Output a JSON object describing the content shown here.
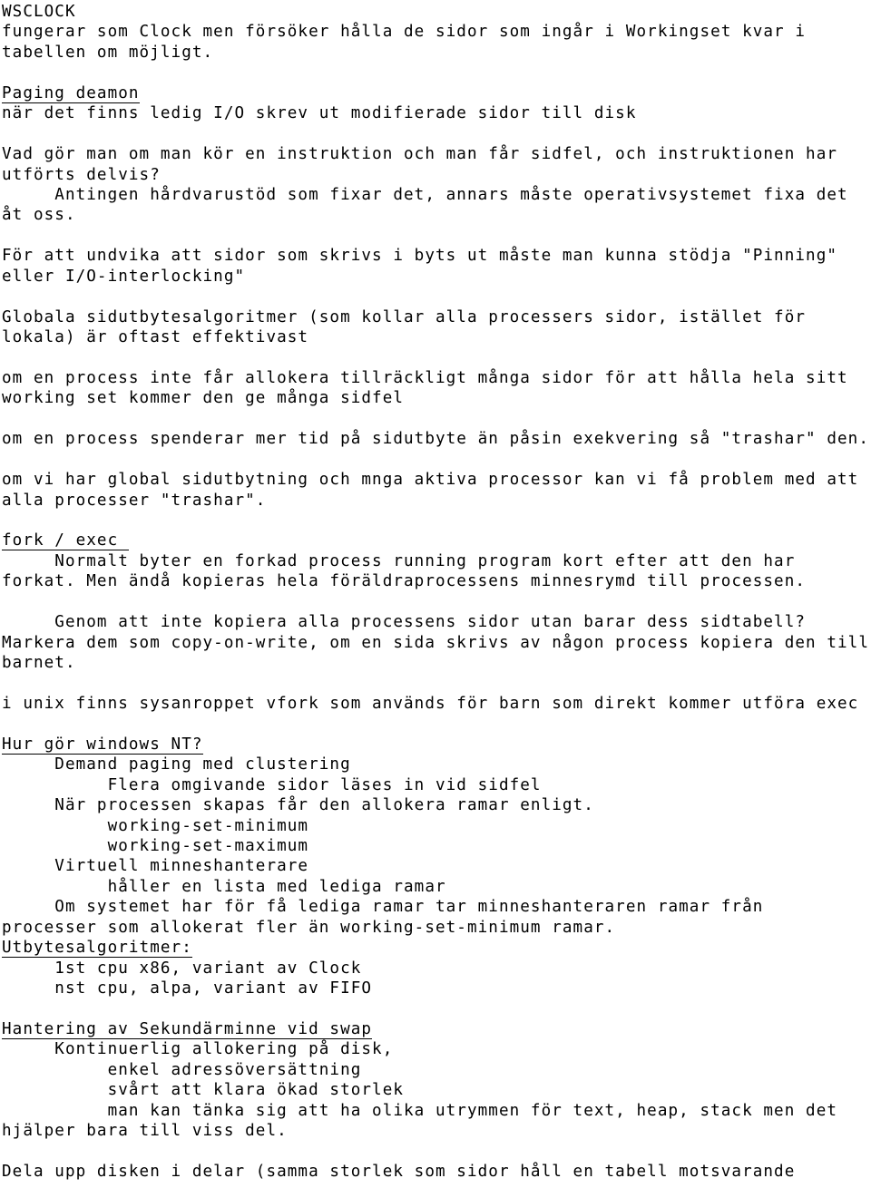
{
  "document": {
    "title": "WSCLOCK",
    "language": "sv",
    "background_color": "#ffffff",
    "text_color": "#000000",
    "lines": [
      {
        "text": "WSCLOCK",
        "style": "plain"
      },
      {
        "text": "fungerar som Clock men försöker hålla de sidor som ingår i Workingset kvar i",
        "style": "plain"
      },
      {
        "text": "tabellen om möjligt.",
        "style": "plain"
      },
      {
        "text": "",
        "style": "blank"
      },
      {
        "text": "Paging deamon",
        "style": "heading"
      },
      {
        "text": "när det finns ledig I/O skrev ut modifierade sidor till disk",
        "style": "plain"
      },
      {
        "text": "",
        "style": "blank"
      },
      {
        "text": "Vad gör man om man kör en instruktion och man får sidfel, och instruktionen har",
        "style": "plain"
      },
      {
        "text": "utförts delvis?",
        "style": "plain"
      },
      {
        "text": "     Antingen hårdvarustöd som fixar det, annars måste operativsystemet fixa det",
        "style": "plain"
      },
      {
        "text": "åt oss.",
        "style": "plain"
      },
      {
        "text": "",
        "style": "blank"
      },
      {
        "text": "För att undvika att sidor som skrivs i byts ut måste man kunna stödja \"Pinning\"",
        "style": "plain"
      },
      {
        "text": "eller I/O-interlocking\"",
        "style": "plain"
      },
      {
        "text": "",
        "style": "blank"
      },
      {
        "text": "Globala sidutbytesalgoritmer (som kollar alla processers sidor, istället för",
        "style": "plain"
      },
      {
        "text": "lokala) är oftast effektivast",
        "style": "plain"
      },
      {
        "text": "",
        "style": "blank"
      },
      {
        "text": "om en process inte får allokera tillräckligt många sidor för att hålla hela sitt",
        "style": "plain"
      },
      {
        "text": "working set kommer den ge många sidfel",
        "style": "plain"
      },
      {
        "text": "",
        "style": "blank"
      },
      {
        "text": "om en process spenderar mer tid på sidutbyte än påsin exekvering så \"trashar\" den.",
        "style": "plain"
      },
      {
        "text": "",
        "style": "blank"
      },
      {
        "text": "om vi har global sidutbytning och mnga aktiva processor kan vi få problem med att",
        "style": "plain"
      },
      {
        "text": "alla processer \"trashar\".",
        "style": "plain"
      },
      {
        "text": "",
        "style": "blank"
      },
      {
        "text": "fork / exec ",
        "style": "heading"
      },
      {
        "text": "     Normalt byter en forkad process running program kort efter att den har",
        "style": "plain"
      },
      {
        "text": "forkat. Men ändå kopieras hela föräldraprocessens minnesrymd till processen.",
        "style": "plain"
      },
      {
        "text": "",
        "style": "blank"
      },
      {
        "text": "     Genom att inte kopiera alla processens sidor utan barar dess sidtabell?",
        "style": "plain"
      },
      {
        "text": "Markera dem som copy-on-write, om en sida skrivs av någon process kopiera den till",
        "style": "plain"
      },
      {
        "text": "barnet.",
        "style": "plain"
      },
      {
        "text": "",
        "style": "blank"
      },
      {
        "text": "i unix finns sysanroppet vfork som används för barn som direkt kommer utföra exec",
        "style": "plain"
      },
      {
        "text": "",
        "style": "blank"
      },
      {
        "text": "Hur gör windows NT?",
        "style": "heading"
      },
      {
        "text": "     Demand paging med clustering",
        "style": "plain"
      },
      {
        "text": "          Flera omgivande sidor läses in vid sidfel",
        "style": "plain"
      },
      {
        "text": "     När processen skapas får den allokera ramar enligt.",
        "style": "plain"
      },
      {
        "text": "          working-set-minimum",
        "style": "plain"
      },
      {
        "text": "          working-set-maximum",
        "style": "plain"
      },
      {
        "text": "     Virtuell minneshanterare",
        "style": "plain"
      },
      {
        "text": "          håller en lista med lediga ramar",
        "style": "plain"
      },
      {
        "text": "     Om systemet har för få lediga ramar tar minneshanteraren ramar från",
        "style": "plain"
      },
      {
        "text": "processer som allokerat fler än working-set-minimum ramar.",
        "style": "plain"
      },
      {
        "text": "Utbytesalgoritmer:",
        "style": "heading"
      },
      {
        "text": "     1st cpu x86, variant av Clock",
        "style": "plain"
      },
      {
        "text": "     nst cpu, alpa, variant av FIFO",
        "style": "plain"
      },
      {
        "text": "",
        "style": "blank"
      },
      {
        "text": "Hantering av Sekundärminne vid swap",
        "style": "heading"
      },
      {
        "text": "     Kontinuerlig allokering på disk,",
        "style": "plain"
      },
      {
        "text": "          enkel adressöversättning",
        "style": "plain"
      },
      {
        "text": "          svårt att klara ökad storlek",
        "style": "plain"
      },
      {
        "text": "          man kan tänka sig att ha olika utrymmen för text, heap, stack men det",
        "style": "plain"
      },
      {
        "text": "hjälper bara till viss del.",
        "style": "plain"
      },
      {
        "text": "",
        "style": "blank"
      },
      {
        "text": "Dela upp disken i delar (samma storlek som sidor håll en tabell motsvarande",
        "style": "plain"
      }
    ]
  }
}
